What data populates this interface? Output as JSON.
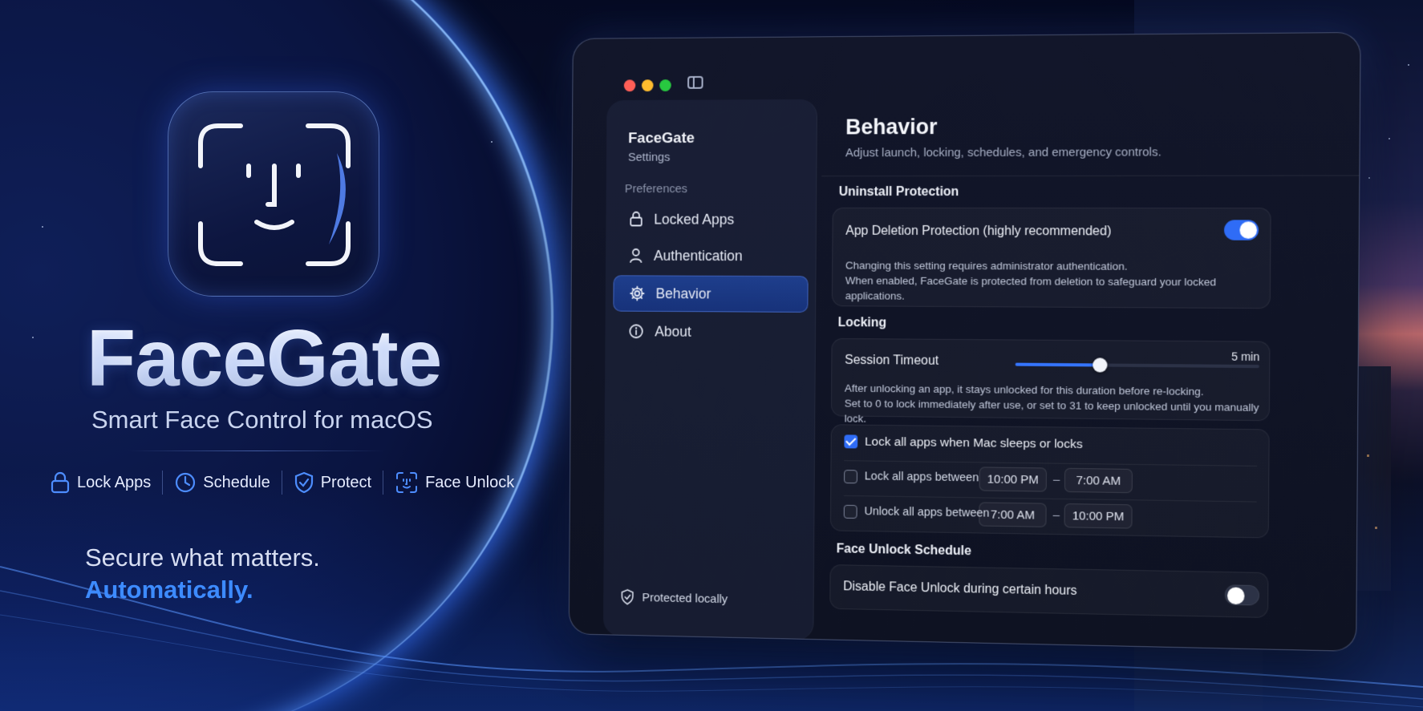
{
  "hero": {
    "brand": "FaceGate",
    "tagline": "Smart Face Control for macOS",
    "features": [
      {
        "label": "Lock Apps",
        "icon": "lock-icon"
      },
      {
        "label": "Schedule",
        "icon": "clock-icon"
      },
      {
        "label": "Protect",
        "icon": "shield-check-icon"
      },
      {
        "label": "Face Unlock",
        "icon": "face-id-icon"
      }
    ],
    "slogan_line1": "Secure what matters.",
    "slogan_line2": "Automatically."
  },
  "sidebar": {
    "app_name": "FaceGate",
    "app_subtitle": "Settings",
    "section": "Preferences",
    "items": [
      {
        "label": "Locked Apps",
        "icon": "lock-icon"
      },
      {
        "label": "Authentication",
        "icon": "person-icon"
      },
      {
        "label": "Behavior",
        "icon": "gear-icon",
        "active": true
      },
      {
        "label": "About",
        "icon": "info-icon"
      }
    ],
    "footer": "Protected locally"
  },
  "main": {
    "title": "Behavior",
    "subtitle": "Adjust launch, locking, schedules, and emergency controls.",
    "uninstall": {
      "section": "Uninstall Protection",
      "label": "App Deletion Protection (highly recommended)",
      "enabled": true,
      "help_line1": "Changing this setting requires administrator authentication.",
      "help_line2": "When enabled, FaceGate is protected from deletion to safeguard your locked applications."
    },
    "locking": {
      "section": "Locking",
      "timeout_label": "Session Timeout",
      "timeout_value": "5 min",
      "timeout_fraction": 0.35,
      "help_line1": "After unlocking an app, it stays unlocked for this duration before re-locking.",
      "help_line2": "Set to 0 to lock immediately after use, or set to 31 to keep unlocked until you manually lock.",
      "sleep_lock_label": "Lock all apps when Mac sleeps or locks",
      "sleep_lock_checked": true,
      "lock_between_label": "Lock all apps between",
      "lock_between_checked": false,
      "lock_from": "10:00 PM",
      "lock_to": "7:00 AM",
      "unlock_between_label": "Unlock all apps between",
      "unlock_between_checked": false,
      "unlock_from": "7:00 AM",
      "unlock_to": "10:00 PM",
      "dash": "–"
    },
    "face_schedule": {
      "section": "Face Unlock Schedule",
      "label": "Disable Face Unlock during certain hours",
      "enabled": false
    }
  },
  "colors": {
    "accent": "#2f6cf6",
    "slogan_accent": "#3d8bff",
    "traffic_red": "#ff5f57",
    "traffic_yellow": "#febc2e",
    "traffic_green": "#28c840"
  }
}
